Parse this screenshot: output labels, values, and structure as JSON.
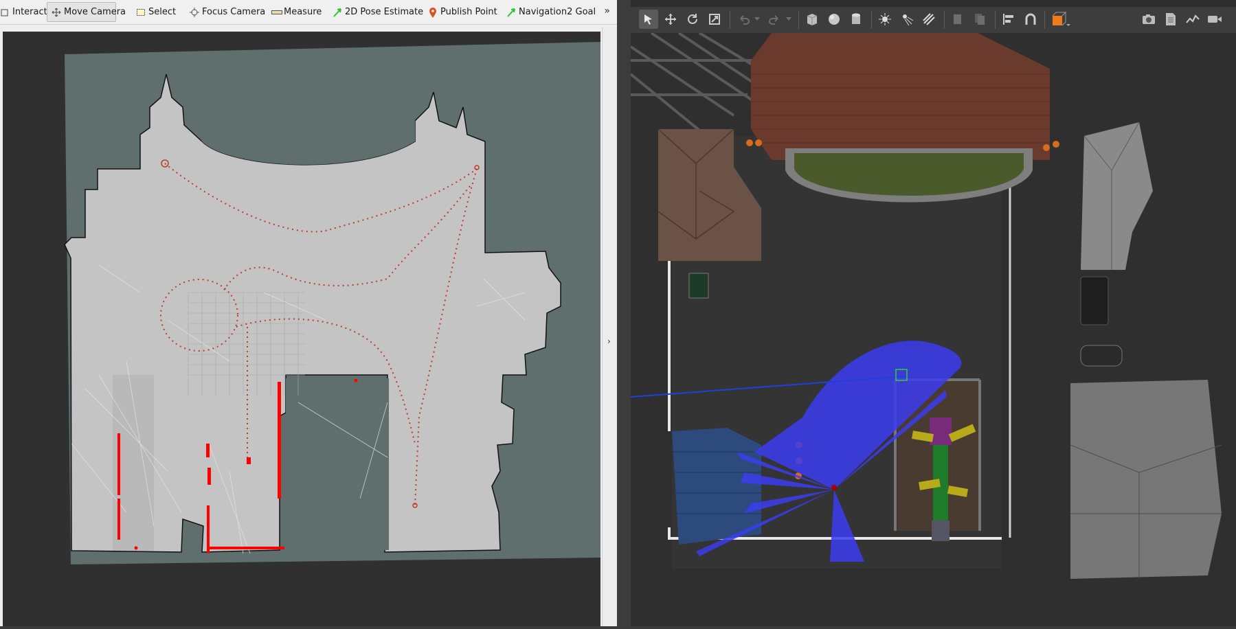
{
  "rviz": {
    "toolbar": {
      "tools": [
        {
          "label": "Interact",
          "icon": "cursor-icon"
        },
        {
          "label": "Move Camera",
          "icon": "move-camera-icon"
        },
        {
          "label": "Select",
          "icon": "select-icon"
        },
        {
          "label": "Focus Camera",
          "icon": "focus-camera-icon"
        },
        {
          "label": "Measure",
          "icon": "ruler-icon"
        },
        {
          "label": "2D Pose Estimate",
          "icon": "green-arrow-icon"
        },
        {
          "label": "Publish Point",
          "icon": "map-pin-icon"
        },
        {
          "label": "Navigation2 Goal",
          "icon": "green-arrow-icon"
        }
      ],
      "overflow_label": "»"
    },
    "collapse_label": "›",
    "colors": {
      "map_free": "#c4c4c4",
      "map_unknown": "#5f6f6e",
      "laser_points": "#ff0000",
      "path": "#c0392b"
    }
  },
  "gazebo": {
    "toolbar": {
      "left_icons": [
        "select-arrow-icon",
        "translate-icon",
        "rotate-icon",
        "scale-icon",
        "undo-icon",
        "undo-dropdown-icon",
        "redo-icon",
        "redo-dropdown-icon",
        "box-icon",
        "sphere-icon",
        "cylinder-icon",
        "point-light-icon",
        "spot-light-icon",
        "directional-light-icon",
        "copy-icon",
        "paste-icon",
        "align-icon",
        "snap-icon",
        "view-angle-icon"
      ],
      "right_icons": [
        "screenshot-icon",
        "log-icon",
        "plot-icon",
        "video-record-icon"
      ]
    },
    "colors": {
      "laser": "#3c3cf0",
      "ground": "#333333",
      "roof": "#6a3a2c"
    }
  }
}
